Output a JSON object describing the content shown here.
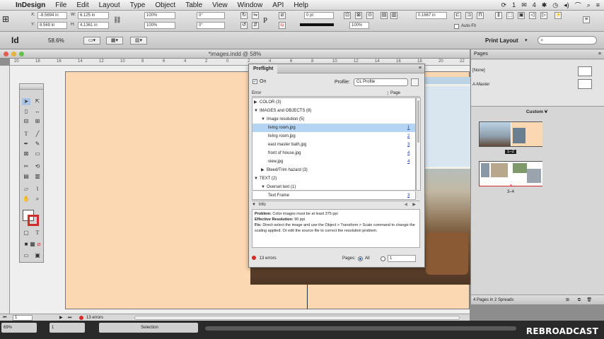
{
  "menubar": {
    "app_name": "InDesign",
    "menus": [
      "File",
      "Edit",
      "Layout",
      "Type",
      "Object",
      "Table",
      "View",
      "Window",
      "API",
      "Help"
    ],
    "status_icons": [
      "1",
      "4"
    ]
  },
  "control": {
    "x_label": "X:",
    "x_value": "-8.5694 in",
    "y_label": "Y:",
    "y_value": "8.569 in",
    "w_label": "W:",
    "w_value": "6.125 in",
    "h_label": "H:",
    "h_value": "4.1361 in",
    "scale_x": "100%",
    "scale_y": "100%",
    "rotate": "0°",
    "shear": "0°",
    "stroke_weight": "0 pt",
    "opacity": "100%",
    "offset": "0.1667 in",
    "auto_fit": "Auto-Fit"
  },
  "appbar": {
    "logo": "Id",
    "zoom": "58.6%",
    "workspace": "Print Layout"
  },
  "document": {
    "title": "*images.indd @ 58%",
    "ruler_marks": [
      "20",
      "18",
      "16",
      "14",
      "12",
      "10",
      "8",
      "6",
      "4",
      "2",
      "0",
      "2",
      "4",
      "6",
      "8",
      "10",
      "12",
      "14",
      "16",
      "18",
      "20",
      "22"
    ]
  },
  "preflight": {
    "tab": "Preflight",
    "on_label": "On",
    "profile_label": "Profile:",
    "profile_value": "CL Profile",
    "col_error": "Error",
    "col_page": "Page",
    "rows": [
      {
        "label": "COLOR (3)",
        "page": "",
        "indent": 0
      },
      {
        "label": "IMAGES and OBJECTS (8)",
        "page": "",
        "indent": 0
      },
      {
        "label": "Image resolution (5)",
        "page": "",
        "indent": 1
      },
      {
        "label": "living room.jpg",
        "page": "1",
        "indent": 2
      },
      {
        "label": "living room.jpg",
        "page": "2",
        "indent": 2
      },
      {
        "label": "east master bath.jpg",
        "page": "3",
        "indent": 2
      },
      {
        "label": "front of house.jpg",
        "page": "4",
        "indent": 2
      },
      {
        "label": "view.jpg",
        "page": "4",
        "indent": 2
      },
      {
        "label": "Bleed/Trim hazard (3)",
        "page": "",
        "indent": 1
      },
      {
        "label": "TEXT (2)",
        "page": "",
        "indent": 0
      },
      {
        "label": "Overset text (1)",
        "page": "",
        "indent": 1
      },
      {
        "label": "Text Frame",
        "page": "3",
        "indent": 2
      }
    ],
    "info_label": "Info",
    "problem_label": "Problem:",
    "problem_text": "Color images must be at least 375 ppi",
    "resolution_label": "Effective Resolution:",
    "resolution_text": "90 ppi",
    "fix_label": "Fix:",
    "fix_text": "Direct-select the image and use the Object > Transform > Scale command to change the scaling applied. Or edit the source file to correct the resolution problem.",
    "errors": "13 errors",
    "pages_label": "Pages:",
    "pages_all": "All",
    "pages_range": "1"
  },
  "pages_panel": {
    "tab": "Pages",
    "none_label": "[None]",
    "master_label": "A-Master",
    "size_label": "Custom V",
    "spread1_label": "1–2",
    "spread2_label": "3–4",
    "footer": "4 Pages in 2 Spreads"
  },
  "doc_footer": {
    "page": "1",
    "errors": "13 errors"
  },
  "statusbar": {
    "zoom": "69%",
    "page": "1",
    "tool": "Selection"
  },
  "watermark": "REBROADCAST"
}
